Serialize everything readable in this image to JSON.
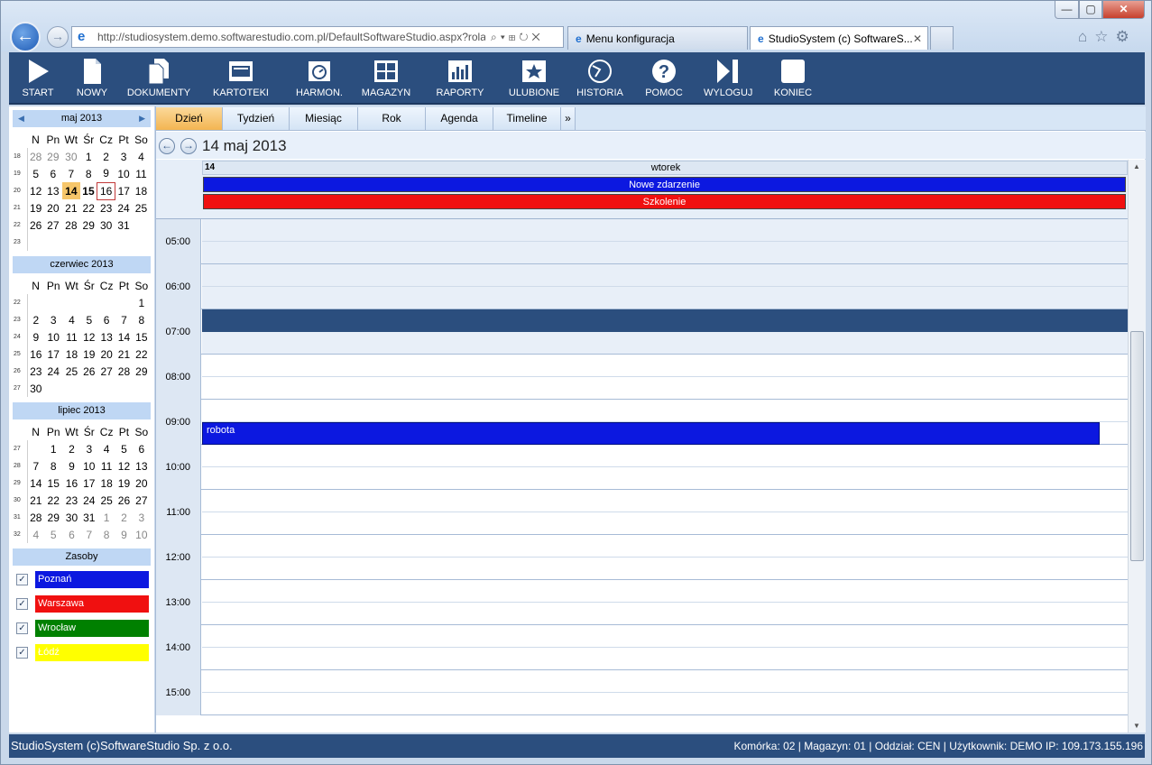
{
  "browser": {
    "url": "http://studiosystem.demo.softwarestudio.com.pl/DefaultSoftwareStudio.aspx?rola",
    "tabs": [
      {
        "label": "Menu konfiguracja"
      },
      {
        "label": "StudioSystem (c) SoftwareS..."
      }
    ],
    "window_buttons": {
      "min": "—",
      "max": "▢",
      "close": "✕"
    }
  },
  "toolbar": {
    "items": [
      {
        "label": "START",
        "icon": "play-icon"
      },
      {
        "label": "NOWY",
        "icon": "new-document-icon"
      },
      {
        "label": "DOKUMENTY",
        "icon": "documents-icon"
      },
      {
        "label": "KARTOTEKI",
        "icon": "card-file-icon"
      },
      {
        "label": "HARMON.",
        "icon": "scheduler-icon"
      },
      {
        "label": "MAGAZYN",
        "icon": "warehouse-icon"
      },
      {
        "label": "RAPORTY",
        "icon": "reports-icon"
      },
      {
        "label": "ULUBIONE",
        "icon": "favorites-icon"
      },
      {
        "label": "HISTORIA",
        "icon": "history-icon"
      },
      {
        "label": "POMOC",
        "icon": "help-icon"
      },
      {
        "label": "WYLOGUJ",
        "icon": "logout-icon"
      },
      {
        "label": "KONIEC",
        "icon": "exit-icon"
      }
    ]
  },
  "calendars": {
    "weekdays": [
      "N",
      "Pn",
      "Wt",
      "Śr",
      "Cz",
      "Pt",
      "So"
    ],
    "may": {
      "title": "maj 2013",
      "weeks": [
        {
          "wk": "18",
          "days": [
            "28",
            "29",
            "30",
            "1",
            "2",
            "3",
            "4"
          ]
        },
        {
          "wk": "19",
          "days": [
            "5",
            "6",
            "7",
            "8",
            "9",
            "10",
            "11"
          ]
        },
        {
          "wk": "20",
          "days": [
            "12",
            "13",
            "14",
            "15",
            "16",
            "17",
            "18"
          ]
        },
        {
          "wk": "21",
          "days": [
            "19",
            "20",
            "21",
            "22",
            "23",
            "24",
            "25"
          ]
        },
        {
          "wk": "22",
          "days": [
            "26",
            "27",
            "28",
            "29",
            "30",
            "31",
            ""
          ]
        },
        {
          "wk": "23",
          "days": [
            "",
            "",
            "",
            "",
            "",
            "",
            ""
          ]
        }
      ]
    },
    "june": {
      "title": "czerwiec 2013",
      "weeks": [
        {
          "wk": "22",
          "days": [
            "",
            "",
            "",
            "",
            "",
            "",
            "1"
          ]
        },
        {
          "wk": "23",
          "days": [
            "2",
            "3",
            "4",
            "5",
            "6",
            "7",
            "8"
          ]
        },
        {
          "wk": "24",
          "days": [
            "9",
            "10",
            "11",
            "12",
            "13",
            "14",
            "15"
          ]
        },
        {
          "wk": "25",
          "days": [
            "16",
            "17",
            "18",
            "19",
            "20",
            "21",
            "22"
          ]
        },
        {
          "wk": "26",
          "days": [
            "23",
            "24",
            "25",
            "26",
            "27",
            "28",
            "29"
          ]
        },
        {
          "wk": "27",
          "days": [
            "30",
            "",
            "",
            "",
            "",
            "",
            ""
          ]
        }
      ]
    },
    "july": {
      "title": "lipiec 2013",
      "weeks": [
        {
          "wk": "27",
          "days": [
            "",
            "1",
            "2",
            "3",
            "4",
            "5",
            "6"
          ]
        },
        {
          "wk": "28",
          "days": [
            "7",
            "8",
            "9",
            "10",
            "11",
            "12",
            "13"
          ]
        },
        {
          "wk": "29",
          "days": [
            "14",
            "15",
            "16",
            "17",
            "18",
            "19",
            "20"
          ]
        },
        {
          "wk": "30",
          "days": [
            "21",
            "22",
            "23",
            "24",
            "25",
            "26",
            "27"
          ]
        },
        {
          "wk": "31",
          "days": [
            "28",
            "29",
            "30",
            "31",
            "1",
            "2",
            "3"
          ]
        },
        {
          "wk": "32",
          "days": [
            "4",
            "5",
            "6",
            "7",
            "8",
            "9",
            "10"
          ]
        }
      ]
    }
  },
  "resources": {
    "title": "Zasoby",
    "items": [
      {
        "label": "Poznań",
        "color": "#0c18e0"
      },
      {
        "label": "Warszawa",
        "color": "#f01010"
      },
      {
        "label": "Wrocław",
        "color": "#008000"
      },
      {
        "label": "Łódź",
        "color": "#ffff00"
      }
    ]
  },
  "scheduler": {
    "views": [
      "Dzień",
      "Tydzień",
      "Miesiąc",
      "Rok",
      "Agenda",
      "Timeline"
    ],
    "active_view": "Dzień",
    "date_title": "14 maj 2013",
    "day_number": "14",
    "day_name": "wtorek",
    "allday_events": [
      {
        "title": "Nowe zdarzenie",
        "color": "#0c18e0"
      },
      {
        "title": "Szkolenie",
        "color": "#f01010"
      }
    ],
    "hours": [
      "05:00",
      "06:00",
      "07:00",
      "08:00",
      "09:00",
      "10:00",
      "11:00",
      "12:00",
      "13:00",
      "14:00",
      "15:00"
    ],
    "events": [
      {
        "title": "robota",
        "start": "09:30",
        "color": "#0c18e0"
      }
    ]
  },
  "status": {
    "left": "StudioSystem (c)SoftwareStudio Sp. z o.o.",
    "right": "Komórka: 02 | Magazyn: 01 | Oddział: CEN | Użytkownik: DEMO IP: 109.173.155.196"
  }
}
